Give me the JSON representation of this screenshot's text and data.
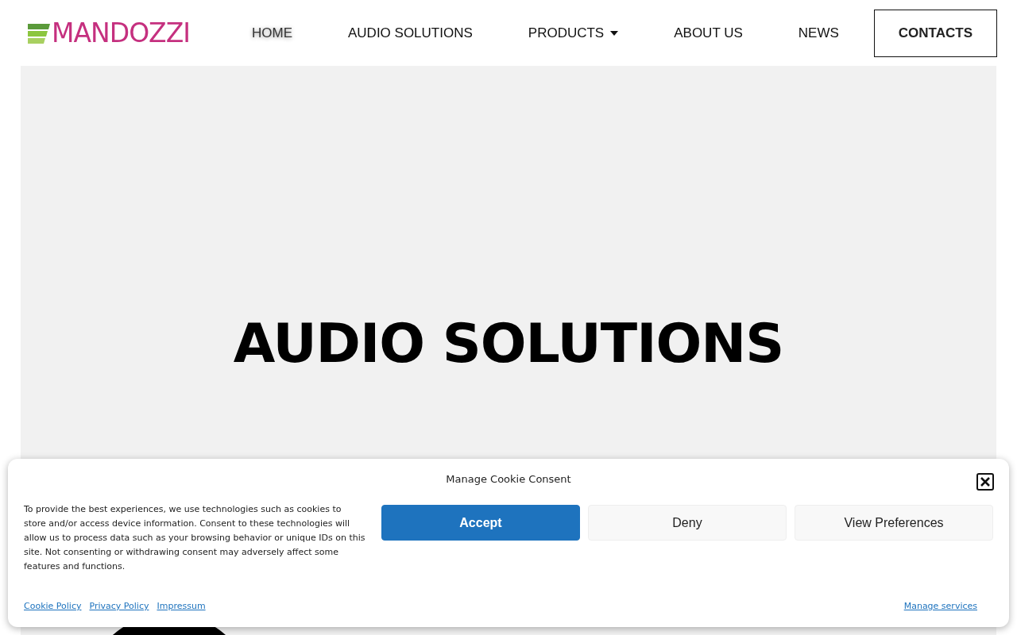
{
  "header": {
    "logo": "MANDOZZI",
    "nav": [
      {
        "label": "HOME",
        "selected": true,
        "dropdown": false
      },
      {
        "label": "AUDIO SOLUTIONS",
        "selected": false,
        "dropdown": false
      },
      {
        "label": "PRODUCTS",
        "selected": false,
        "dropdown": true
      },
      {
        "label": "ABOUT US",
        "selected": false,
        "dropdown": false
      },
      {
        "label": "NEWS",
        "selected": false,
        "dropdown": false
      }
    ],
    "cta": "CONTACTS"
  },
  "hero": {
    "title": "AUDIO SOLUTIONS"
  },
  "cookie_banner": {
    "title": "Manage Cookie Consent",
    "text": "To provide the best experiences, we use technologies such as cookies to store and/or access device information. Consent to these technologies will allow us to process data such as your browsing behavior or unique IDs on this site. Not consenting or withdrawing consent may adversely affect some features and functions.",
    "buttons": [
      {
        "label": "Accept",
        "kind": "primary"
      },
      {
        "label": "Deny",
        "kind": "secondary"
      },
      {
        "label": "View Preferences",
        "kind": "secondary"
      }
    ],
    "links": [
      "Cookie Policy",
      "Privacy Policy",
      "Impressum"
    ],
    "manage_link": "Manage services"
  }
}
